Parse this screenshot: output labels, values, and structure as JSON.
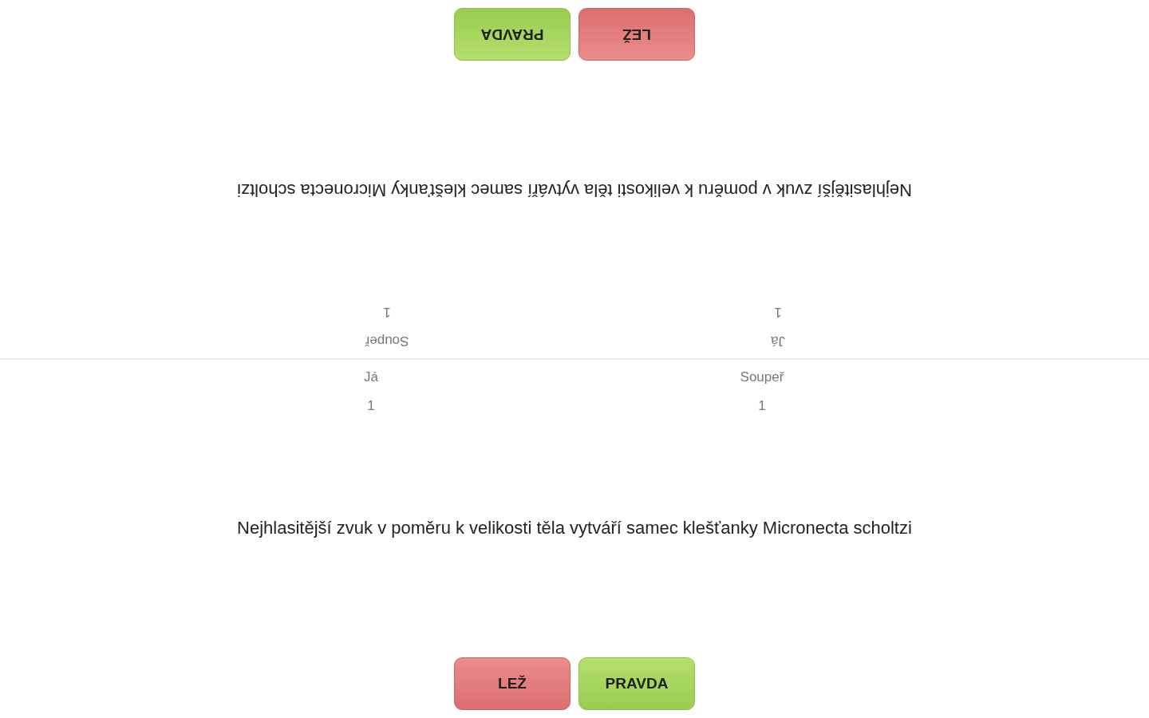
{
  "halves": [
    {
      "rotated": true,
      "scores": [
        {
          "label": "Já",
          "value": "1"
        },
        {
          "label": "Soupeř",
          "value": "1"
        }
      ],
      "question": "Nejhlasitější zvuk v poměru k velikosti těla vytváří samec klešťanky Micronecta scholtzi",
      "buttons": [
        {
          "kind": "lie",
          "label": "LEŽ"
        },
        {
          "kind": "truth",
          "label": "PRAVDA"
        }
      ]
    },
    {
      "rotated": false,
      "scores": [
        {
          "label": "Já",
          "value": "1"
        },
        {
          "label": "Soupeř",
          "value": "1"
        }
      ],
      "question": "Nejhlasitější zvuk v poměru k velikosti těla vytváří samec klešťanky Micronecta scholtzi",
      "buttons": [
        {
          "kind": "lie",
          "label": "LEŽ"
        },
        {
          "kind": "truth",
          "label": "PRAVDA"
        }
      ]
    }
  ]
}
